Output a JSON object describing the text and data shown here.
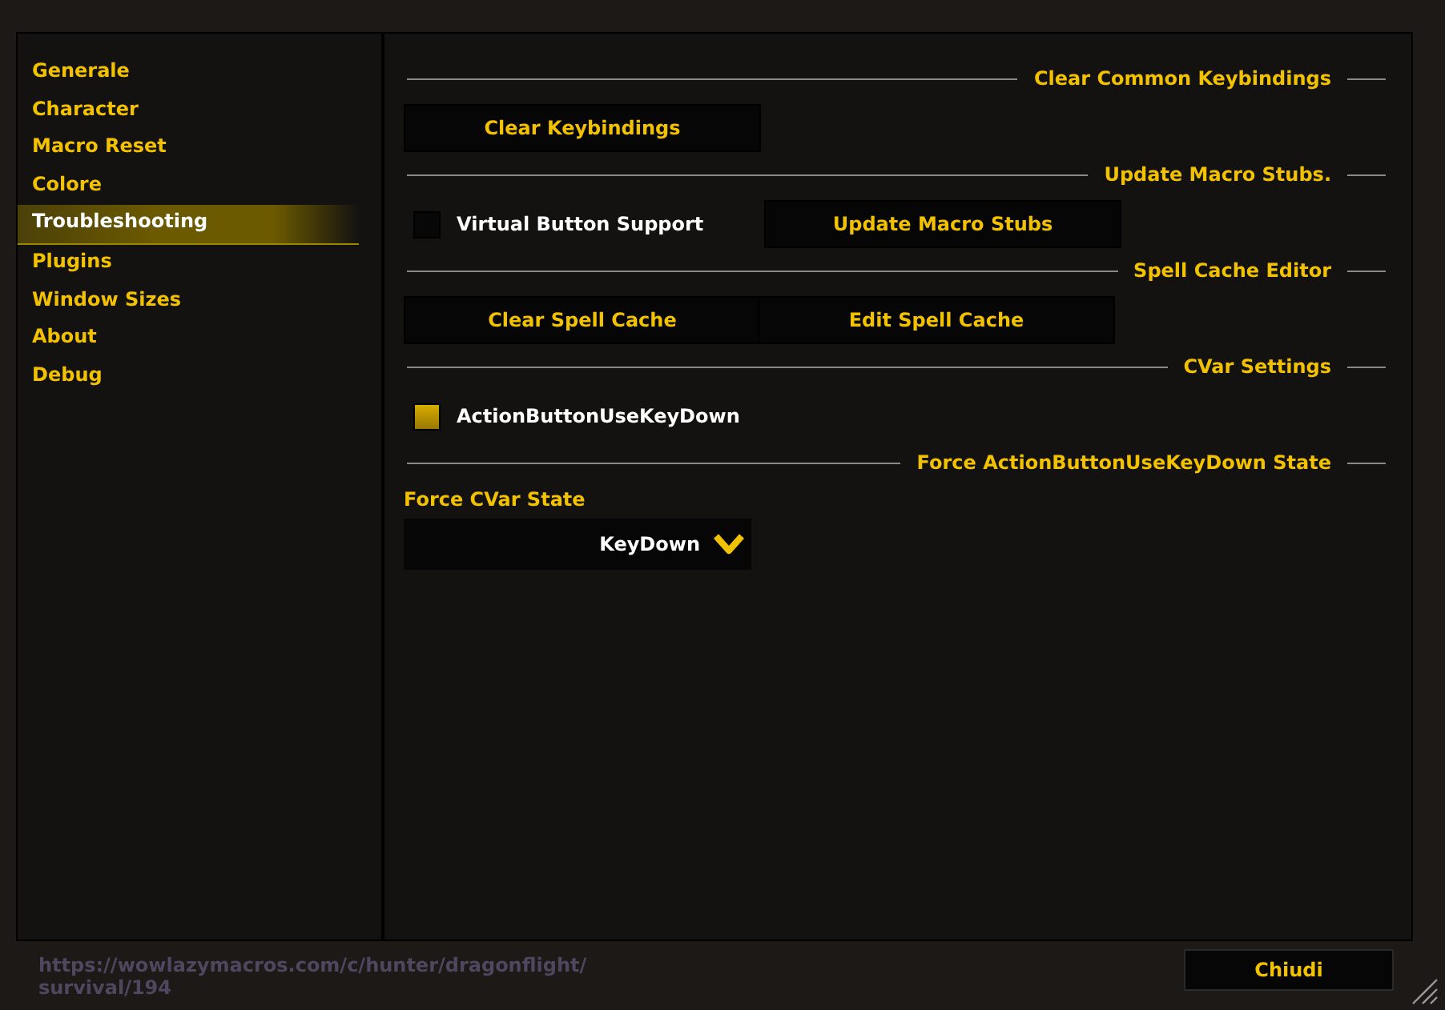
{
  "sidebar": {
    "items": [
      {
        "label": "Generale",
        "selected": false
      },
      {
        "label": "Character",
        "selected": false
      },
      {
        "label": "Macro Reset",
        "selected": false
      },
      {
        "label": "Colore",
        "selected": false
      },
      {
        "label": "Troubleshooting",
        "selected": true
      },
      {
        "label": "Plugins",
        "selected": false
      },
      {
        "label": "Window Sizes",
        "selected": false
      },
      {
        "label": "About",
        "selected": false
      },
      {
        "label": "Debug",
        "selected": false
      }
    ]
  },
  "sections": [
    {
      "heading": "Clear Common Keybindings",
      "items": [
        {
          "kind": "button",
          "label": "Clear Keybindings"
        }
      ]
    },
    {
      "heading": "Update Macro Stubs.",
      "items": [
        {
          "kind": "checkbox",
          "label": "Virtual Button Support",
          "checked": false
        },
        {
          "kind": "button",
          "label": "Update Macro Stubs"
        }
      ]
    },
    {
      "heading": "Spell Cache Editor",
      "items": [
        {
          "kind": "button",
          "label": "Clear Spell Cache"
        },
        {
          "kind": "button",
          "label": "Edit Spell Cache"
        }
      ]
    },
    {
      "heading": "CVar Settings",
      "items": [
        {
          "kind": "checkbox",
          "label": "ActionButtonUseKeyDown",
          "checked": true
        }
      ]
    },
    {
      "heading": "Force ActionButtonUseKeyDown State",
      "items": [
        {
          "kind": "dropdown",
          "label": "Force CVar State",
          "value": "KeyDown"
        }
      ]
    }
  ],
  "background_text": "https://wowlazymacros.com/c/hunter/dragonflight/ survival/194",
  "close_button": "Chiudi"
}
